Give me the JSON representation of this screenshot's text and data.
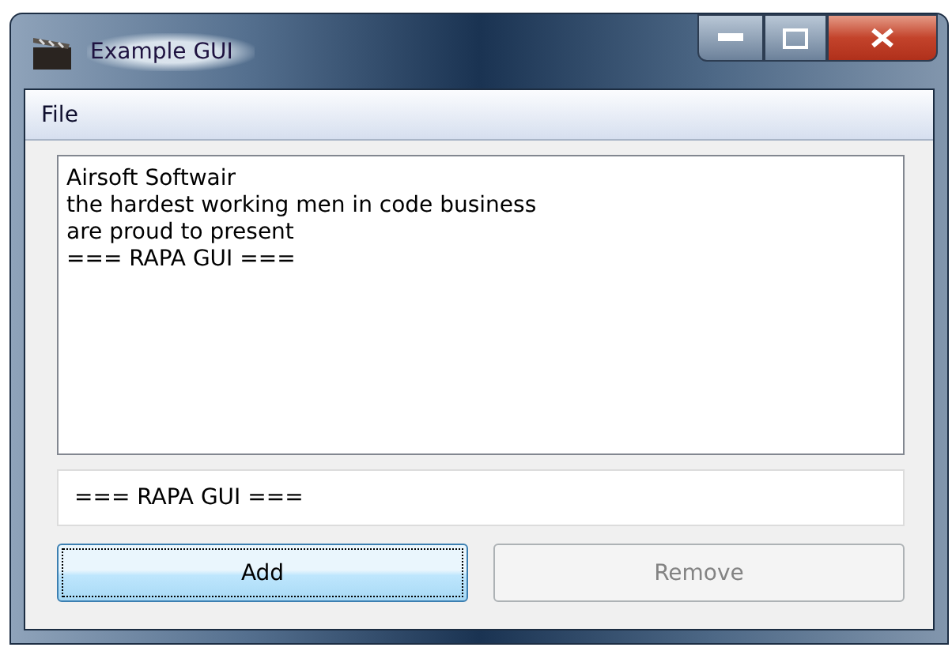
{
  "window": {
    "title": "Example GUI"
  },
  "menu": [
    "File"
  ],
  "list": [
    "Airsoft Softwair",
    "the hardest working men in code business",
    "are proud to present",
    "=== RAPA GUI ==="
  ],
  "input": {
    "value": "=== RAPA GUI ==="
  },
  "buttons": [
    {
      "label": "Add",
      "disabled": false,
      "focused": true
    },
    {
      "label": "Remove",
      "disabled": true,
      "focused": false
    }
  ]
}
